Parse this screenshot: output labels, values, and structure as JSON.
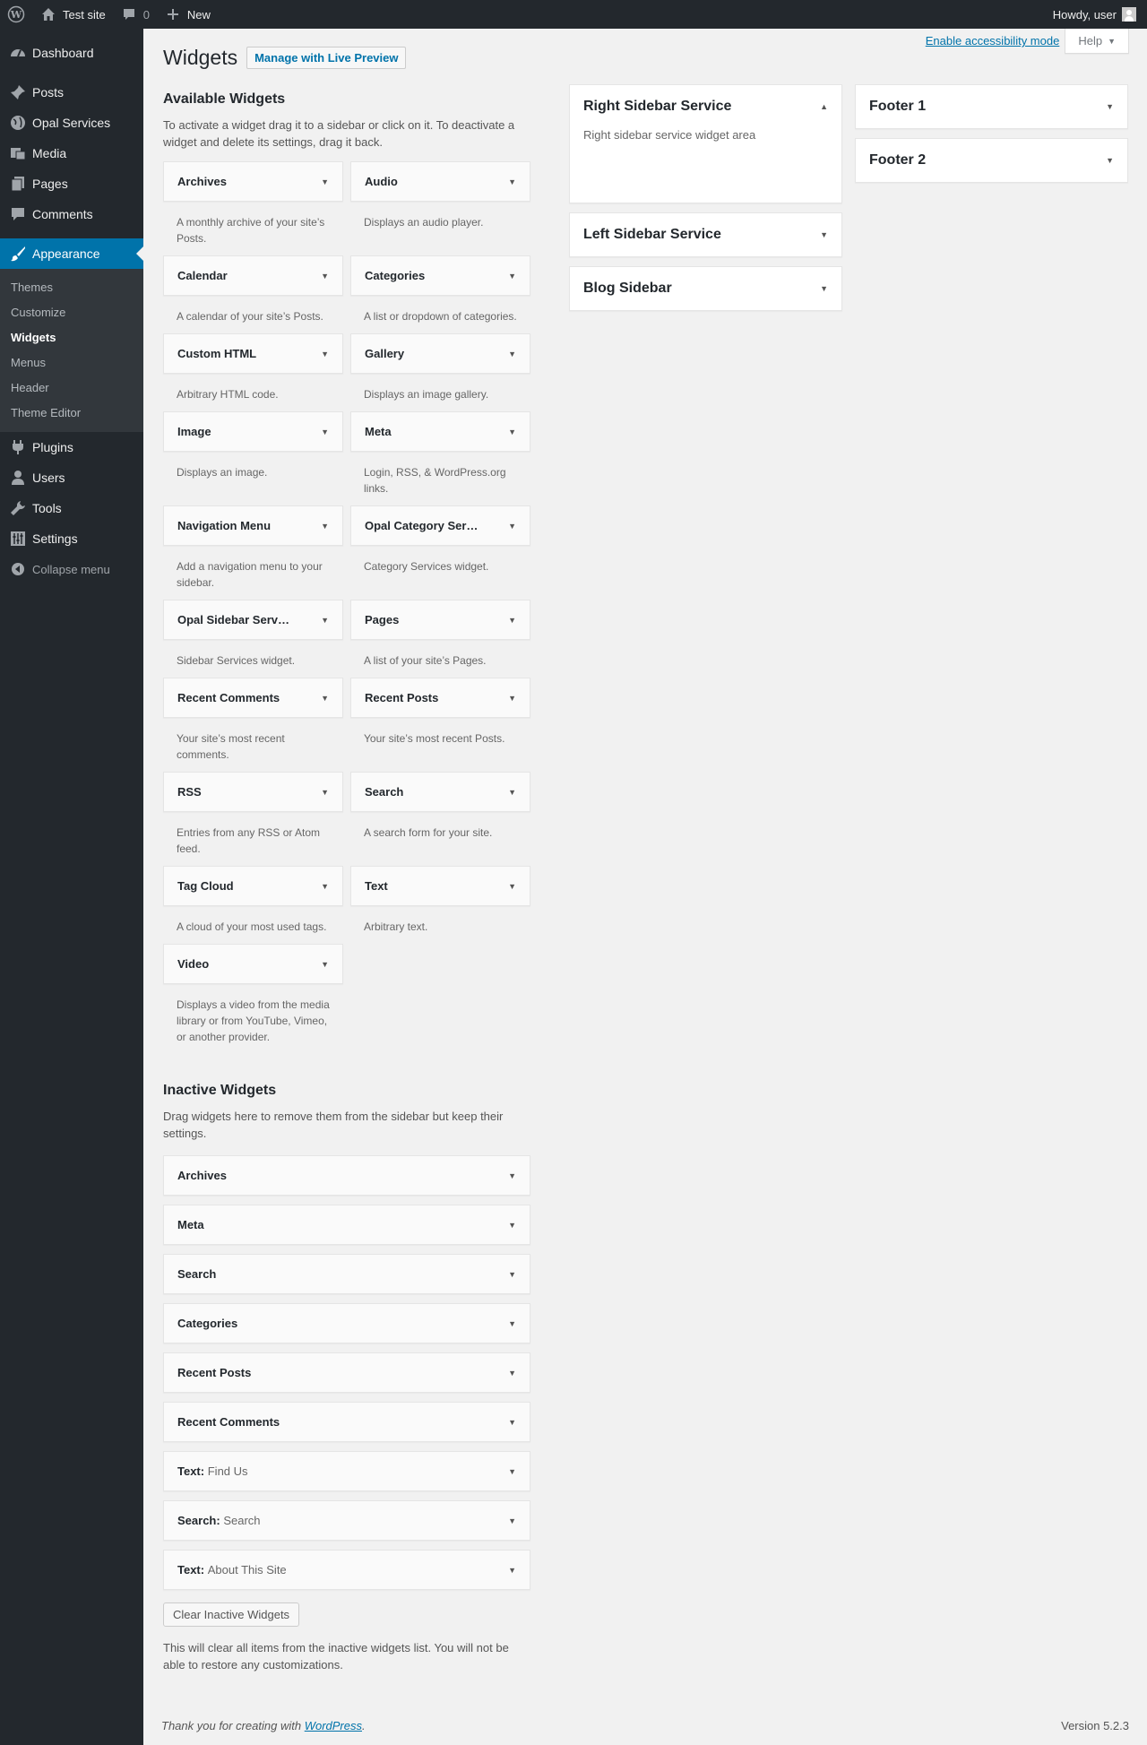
{
  "adminbar": {
    "site_name": "Test site",
    "comments_count": "0",
    "new_label": "New",
    "howdy": "Howdy, user"
  },
  "menu": {
    "dashboard": "Dashboard",
    "posts": "Posts",
    "opal_services": "Opal Services",
    "media": "Media",
    "pages": "Pages",
    "comments": "Comments",
    "appearance": "Appearance",
    "appearance_sub": [
      "Themes",
      "Customize",
      "Widgets",
      "Menus",
      "Header",
      "Theme Editor"
    ],
    "plugins": "Plugins",
    "users": "Users",
    "tools": "Tools",
    "settings": "Settings",
    "collapse": "Collapse menu"
  },
  "screen_meta": {
    "accessibility": "Enable accessibility mode",
    "help": "Help"
  },
  "page": {
    "title": "Widgets",
    "live_preview": "Manage with Live Preview"
  },
  "available": {
    "title": "Available Widgets",
    "desc": "To activate a widget drag it to a sidebar or click on it. To deactivate a widget and delete its settings, drag it back.",
    "widgets": [
      {
        "title": "Archives",
        "desc": "A monthly archive of your site’s Posts."
      },
      {
        "title": "Audio",
        "desc": "Displays an audio player."
      },
      {
        "title": "Calendar",
        "desc": "A calendar of your site’s Posts."
      },
      {
        "title": "Categories",
        "desc": "A list or dropdown of categories."
      },
      {
        "title": "Custom HTML",
        "desc": "Arbitrary HTML code."
      },
      {
        "title": "Gallery",
        "desc": "Displays an image gallery."
      },
      {
        "title": "Image",
        "desc": "Displays an image."
      },
      {
        "title": "Meta",
        "desc": "Login, RSS, & WordPress.org links."
      },
      {
        "title": "Navigation Menu",
        "desc": "Add a navigation menu to your sidebar."
      },
      {
        "title": "Opal Category Ser…",
        "desc": "Category Services widget."
      },
      {
        "title": "Opal Sidebar Serv…",
        "desc": "Sidebar Services widget."
      },
      {
        "title": "Pages",
        "desc": "A list of your site’s Pages."
      },
      {
        "title": "Recent Comments",
        "desc": "Your site’s most recent comments."
      },
      {
        "title": "Recent Posts",
        "desc": "Your site’s most recent Posts."
      },
      {
        "title": "RSS",
        "desc": "Entries from any RSS or Atom feed."
      },
      {
        "title": "Search",
        "desc": "A search form for your site."
      },
      {
        "title": "Tag Cloud",
        "desc": "A cloud of your most used tags."
      },
      {
        "title": "Text",
        "desc": "Arbitrary text."
      },
      {
        "title": "Video",
        "desc": "Displays a video from the media library or from YouTube, Vimeo, or another provider."
      }
    ]
  },
  "inactive": {
    "title": "Inactive Widgets",
    "desc": "Drag widgets here to remove them from the sidebar but keep their settings.",
    "widgets": [
      {
        "title": "Archives",
        "sub": ""
      },
      {
        "title": "Meta",
        "sub": ""
      },
      {
        "title": "Search",
        "sub": ""
      },
      {
        "title": "Categories",
        "sub": ""
      },
      {
        "title": "Recent Posts",
        "sub": ""
      },
      {
        "title": "Recent Comments",
        "sub": ""
      },
      {
        "title": "Text:",
        "sub": "Find Us"
      },
      {
        "title": "Search:",
        "sub": "Search"
      },
      {
        "title": "Text:",
        "sub": "About This Site"
      }
    ],
    "clear_button": "Clear Inactive Widgets",
    "clear_desc": "This will clear all items from the inactive widgets list. You will not be able to restore any customizations."
  },
  "sidebars_mid": [
    {
      "title": "Right Sidebar Service",
      "desc": "Right sidebar service widget area",
      "open": true
    },
    {
      "title": "Left Sidebar Service",
      "desc": "",
      "open": false
    },
    {
      "title": "Blog Sidebar",
      "desc": "",
      "open": false
    }
  ],
  "sidebars_right": [
    {
      "title": "Footer 1",
      "desc": "",
      "open": false
    },
    {
      "title": "Footer 2",
      "desc": "",
      "open": false
    }
  ],
  "footer": {
    "thanks_prefix": "Thank you for creating with ",
    "wp_link": "WordPress",
    "thanks_suffix": ".",
    "version": "Version 5.2.3"
  },
  "colors": {
    "adminbar_bg": "#23282d",
    "accent": "#0073aa",
    "submenu_bg": "#32373c"
  }
}
